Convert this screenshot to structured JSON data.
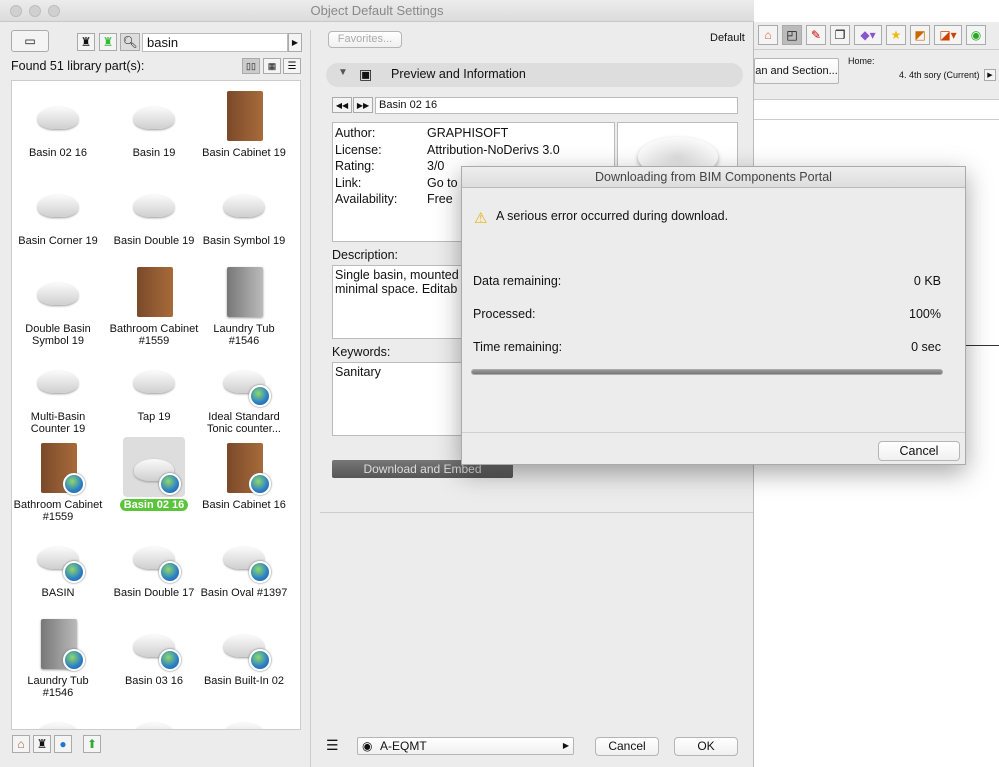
{
  "window": {
    "title": "Object Default Settings"
  },
  "library": {
    "search_value": "basin",
    "found_label": "Found 51 library part(s):",
    "items": [
      {
        "label": "Basin 02 16",
        "kind": "basin",
        "globe": false
      },
      {
        "label": "Basin 19",
        "kind": "basin",
        "globe": false
      },
      {
        "label": "Basin Cabinet 19",
        "kind": "cab",
        "globe": false
      },
      {
        "label": "Basin Corner 19",
        "kind": "basin",
        "globe": false
      },
      {
        "label": "Basin Double 19",
        "kind": "basin",
        "globe": false
      },
      {
        "label": "Basin Symbol 19",
        "kind": "basin",
        "globe": false
      },
      {
        "label": "Double Basin Symbol 19",
        "kind": "basin",
        "globe": false
      },
      {
        "label": "Bathroom Cabinet #1559",
        "kind": "cab",
        "globe": false
      },
      {
        "label": "Laundry Tub #1546",
        "kind": "grey",
        "globe": false
      },
      {
        "label": "Multi-Basin Counter 19",
        "kind": "basin",
        "globe": false
      },
      {
        "label": "Tap 19",
        "kind": "basin",
        "globe": false
      },
      {
        "label": "Ideal Standard Tonic counter...",
        "kind": "basin",
        "globe": true
      },
      {
        "label": "Bathroom Cabinet #1559",
        "kind": "cab",
        "globe": true
      },
      {
        "label": "Basin 02 16",
        "kind": "basin",
        "globe": true,
        "selected": true
      },
      {
        "label": "Basin Cabinet 16",
        "kind": "cab",
        "globe": true
      },
      {
        "label": "BASIN",
        "kind": "basin",
        "globe": true
      },
      {
        "label": "Basin Double 17",
        "kind": "basin",
        "globe": true
      },
      {
        "label": "Basin Oval #1397",
        "kind": "basin",
        "globe": true
      },
      {
        "label": "Laundry Tub #1546",
        "kind": "grey",
        "globe": true
      },
      {
        "label": "Basin 03 16",
        "kind": "basin",
        "globe": true
      },
      {
        "label": "Basin Built-In 02",
        "kind": "basin",
        "globe": true
      },
      {
        "label": "",
        "kind": "basin",
        "globe": false
      },
      {
        "label": "",
        "kind": "basin",
        "globe": false
      },
      {
        "label": "",
        "kind": "basin",
        "globe": false
      }
    ]
  },
  "settings": {
    "favorites_label": "Favorites...",
    "default_label": "Default",
    "section_title": "Preview and Information",
    "part_name": "Basin 02 16",
    "info": [
      {
        "key": "Author:",
        "value": "GRAPHISOFT"
      },
      {
        "key": "License:",
        "value": "Attribution-NoDerivs 3.0"
      },
      {
        "key": "Rating:",
        "value": "3/0"
      },
      {
        "key": "Link:",
        "value": "Go to"
      },
      {
        "key": "Availability:",
        "value": "Free"
      }
    ],
    "description_label": "Description:",
    "description": "Single basin, mounted\nminimal space.  Editab",
    "keywords_label": "Keywords:",
    "keywords": "Sanitary",
    "download_button": "Download and Embed",
    "layer": "A-EQMT",
    "cancel": "Cancel",
    "ok": "OK"
  },
  "background_app": {
    "tab_label": "an and Section...",
    "home_label": "Home:",
    "story": "4. 4th sory (Current)"
  },
  "modal": {
    "title": "Downloading from BIM Components Portal",
    "error": "A serious error occurred during download.",
    "rows": [
      {
        "label": "Data remaining:",
        "value": "0 KB"
      },
      {
        "label": "Processed:",
        "value": "100%"
      },
      {
        "label": "Time remaining:",
        "value": "0 sec"
      }
    ],
    "progress": 1.0,
    "cancel": "Cancel"
  }
}
